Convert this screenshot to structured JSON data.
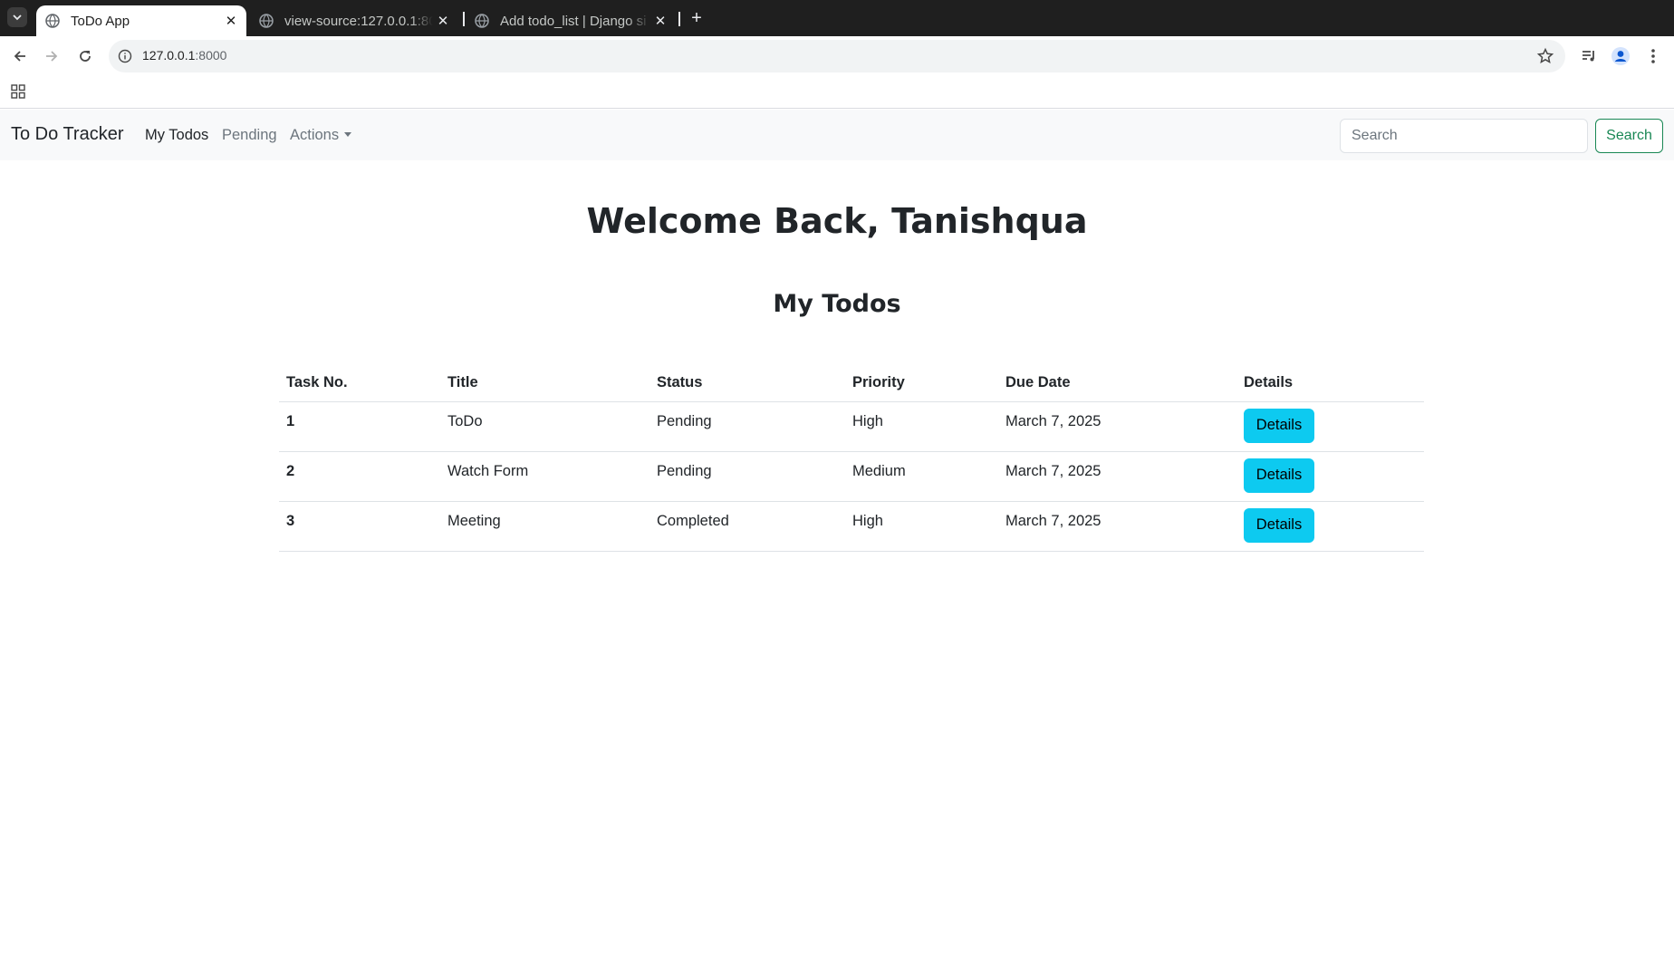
{
  "browser": {
    "tabs": [
      {
        "title": "ToDo App",
        "active": true
      },
      {
        "title": "view-source:127.0.0.1:80",
        "active": false
      },
      {
        "title": "Add todo_list | Django si",
        "active": false
      }
    ],
    "url_host": "127.0.0.1",
    "url_port": ":8000"
  },
  "navbar": {
    "brand": "To Do Tracker",
    "links": [
      "My Todos",
      "Pending",
      "Actions"
    ],
    "search_placeholder": "Search",
    "search_button": "Search"
  },
  "main": {
    "welcome": "Welcome Back, Tanishqua",
    "section_title": "My Todos"
  },
  "table": {
    "headers": [
      "Task No.",
      "Title",
      "Status",
      "Priority",
      "Due Date",
      "Details"
    ],
    "rows": [
      {
        "num": "1",
        "title": "ToDo",
        "status": "Pending",
        "priority": "High",
        "due": "March 7, 2025",
        "action": "Details"
      },
      {
        "num": "2",
        "title": "Watch Form",
        "status": "Pending",
        "priority": "Medium",
        "due": "March 7, 2025",
        "action": "Details"
      },
      {
        "num": "3",
        "title": "Meeting",
        "status": "Completed",
        "priority": "High",
        "due": "March 7, 2025",
        "action": "Details"
      }
    ]
  },
  "colors": {
    "info_button": "#0dcaf0",
    "success_outline": "#198754",
    "navbar_bg": "#f8f9fa"
  }
}
